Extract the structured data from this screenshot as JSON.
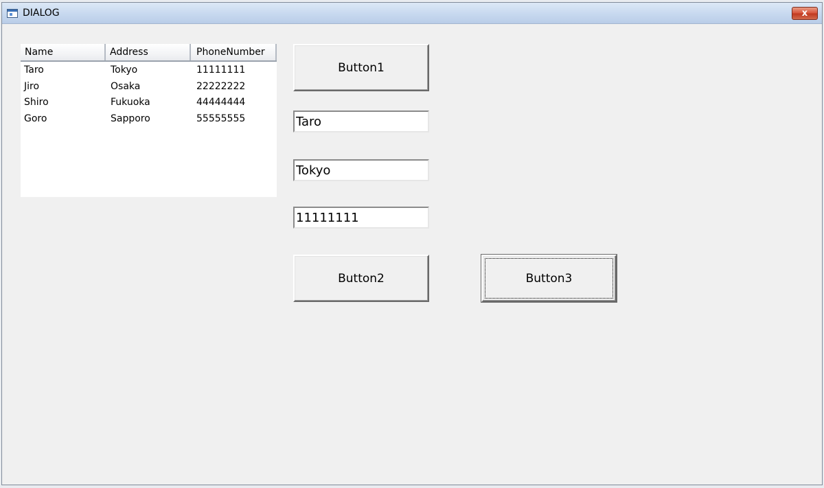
{
  "window": {
    "title": "DIALOG",
    "close_label": "x"
  },
  "listview": {
    "columns": [
      "Name",
      "Address",
      "PhoneNumber"
    ],
    "rows": [
      [
        "Taro",
        "Tokyo",
        "11111111"
      ],
      [
        "Jiro",
        "Osaka",
        "22222222"
      ],
      [
        "Shiro",
        "Fukuoka",
        "44444444"
      ],
      [
        "Goro",
        "Sapporo",
        "55555555"
      ]
    ]
  },
  "buttons": {
    "button1": "Button1",
    "button2": "Button2",
    "button3": "Button3"
  },
  "fields": {
    "name": "Taro",
    "address": "Tokyo",
    "phone": "11111111"
  },
  "icons": {
    "app": "window-app-icon",
    "close": "close-icon"
  },
  "colors": {
    "titlebar": "#c9daf0",
    "close_button": "#d7553b",
    "dialog_background": "#f0f0f0"
  }
}
